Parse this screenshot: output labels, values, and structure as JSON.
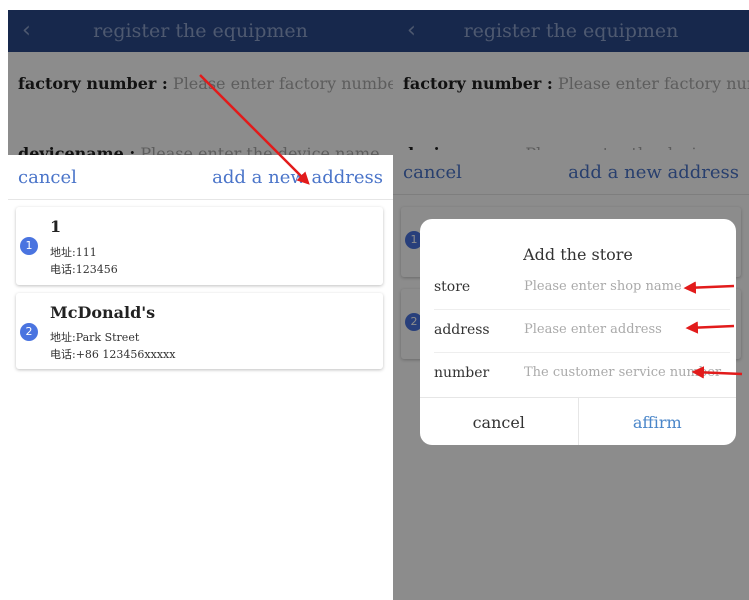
{
  "left": {
    "header": {
      "back_icon": "‹",
      "title": "register the equipmen"
    },
    "form": {
      "factory_label": "factory number :",
      "factory_placeholder": "Please enter factory numbe",
      "device_label": "devicename :",
      "device_placeholder": "Please enter the device name"
    },
    "sheet": {
      "cancel": "cancel",
      "add": "add a new address",
      "addresses": [
        {
          "index": "1",
          "name": "1",
          "address": "地址:111",
          "phone": "电话:123456"
        },
        {
          "index": "2",
          "name": "McDonald's",
          "address": "地址:Park Street",
          "phone": "电话:+86 123456xxxxx"
        }
      ]
    }
  },
  "right": {
    "header": {
      "back_icon": "‹",
      "title": "register the equipmen"
    },
    "form": {
      "factory_label": "factory number :",
      "factory_placeholder": "Please enter factory numbe",
      "device_label": "devicename :",
      "device_placeholder": "Please enter the device name"
    },
    "sheet": {
      "cancel": "cancel",
      "add": "add a new address"
    },
    "dialog": {
      "title": "Add the store",
      "fields": [
        {
          "label": "store",
          "placeholder": "Please enter shop name"
        },
        {
          "label": "address",
          "placeholder": "Please enter address"
        },
        {
          "label": "number",
          "placeholder": "The customer service number"
        }
      ],
      "cancel": "cancel",
      "confirm": "affirm"
    }
  },
  "colors": {
    "header_bg": "#2b4a8a",
    "accent": "#4a74c9",
    "annotation_arrow": "#e21b1b"
  }
}
